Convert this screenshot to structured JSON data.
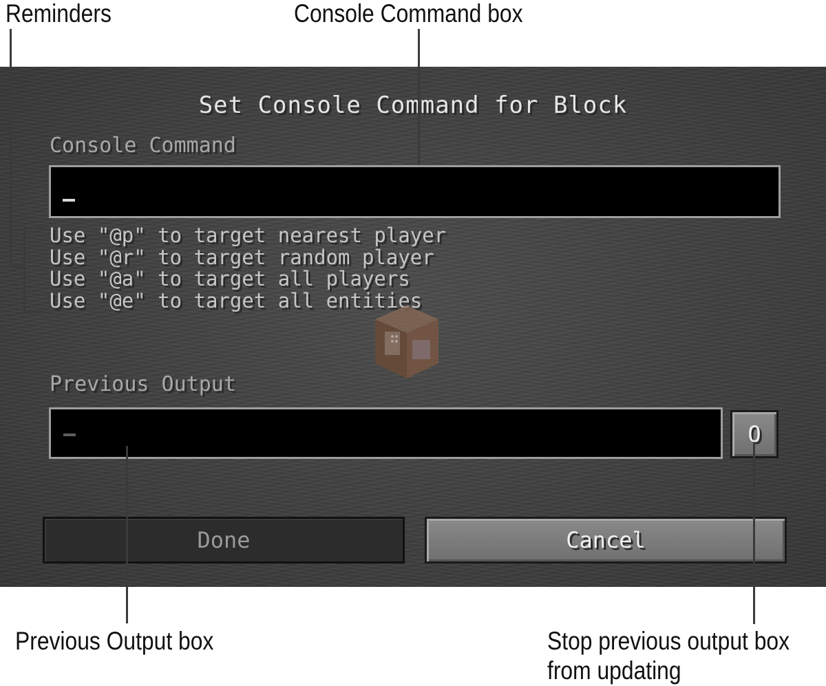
{
  "callouts": {
    "reminders": "Reminders",
    "console_command_box": "Console Command box",
    "previous_output_box": "Previous Output box",
    "stop_updating_line1": "Stop previous output box",
    "stop_updating_line2": "from updating"
  },
  "dialog": {
    "title": "Set Console Command for Block",
    "command_label": "Console Command",
    "command_value": "",
    "hints": [
      "Use \"@p\" to target nearest player",
      "Use \"@r\" to target random player",
      "Use \"@a\" to target all players",
      "Use \"@e\" to target all entities"
    ],
    "output_label": "Previous Output",
    "output_value": "-",
    "track_output_label": "O",
    "done_label": "Done",
    "cancel_label": "Cancel"
  },
  "colors": {
    "screen_background": "#404040",
    "textbox_background": "#000000",
    "textbox_border": "#9e9e9e",
    "title_text": "#e6e6e6",
    "label_text": "#a8a8a8"
  },
  "icons": {
    "background_block": "command-block-icon"
  }
}
